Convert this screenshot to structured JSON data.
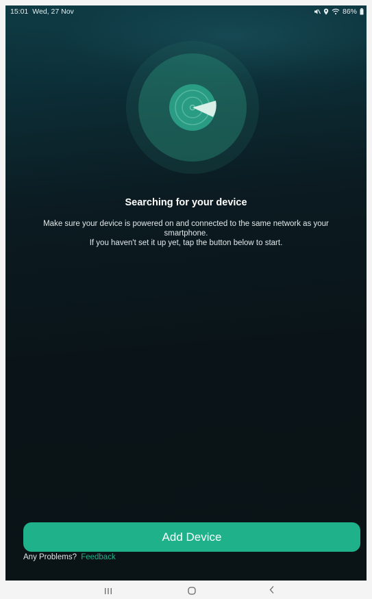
{
  "status_bar": {
    "time": "15:01",
    "date": "Wed, 27 Nov",
    "battery": "86%",
    "icons": [
      "mute-icon",
      "location-icon",
      "wifi-icon",
      "battery-icon"
    ]
  },
  "search": {
    "title": "Searching for your device",
    "description_line1": "Make sure your device is powered on and connected to the same network as your smartphone.",
    "description_line2": "If you haven't set it up yet, tap the button below to start."
  },
  "actions": {
    "add_device_label": "Add Device",
    "problems_label": "Any Problems?",
    "feedback_label": "Feedback"
  },
  "nav_bar": {
    "icons": [
      "recents-icon",
      "home-icon",
      "back-icon"
    ]
  },
  "colors": {
    "accent": "#1fb18a",
    "background": "#0b1b21",
    "nav_bar": "#f4f4f4"
  }
}
